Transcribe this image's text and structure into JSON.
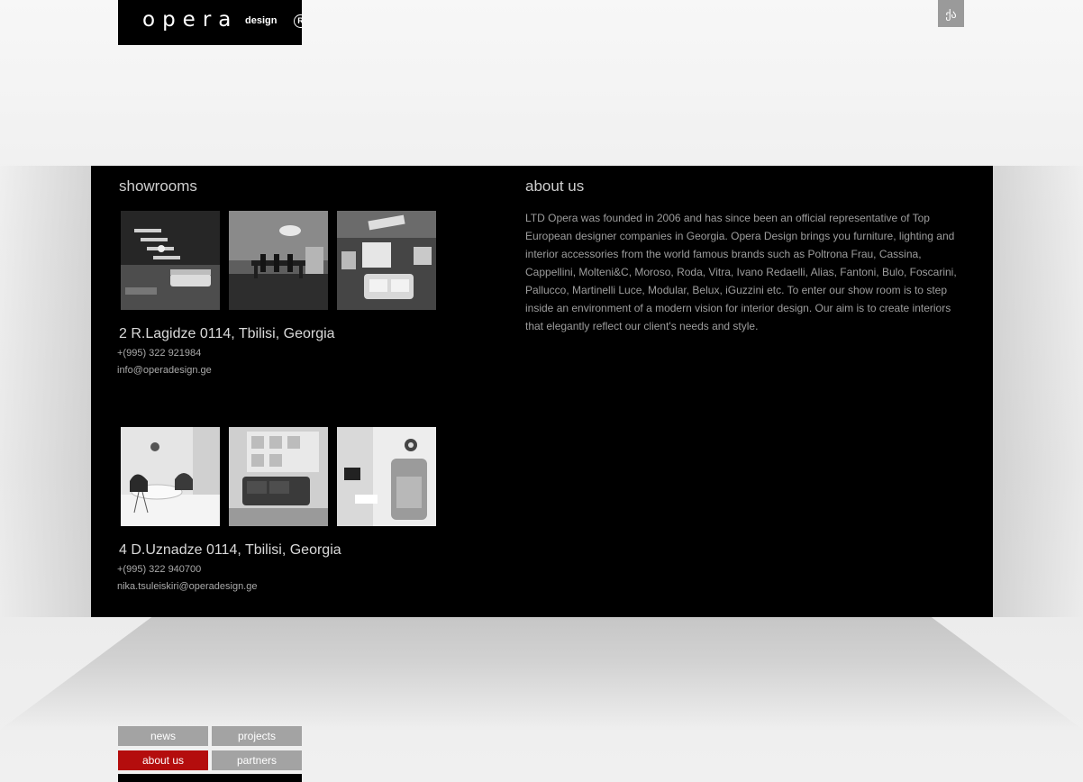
{
  "logo": {
    "word": "opera",
    "subword": "design",
    "mark": "R"
  },
  "language_switch": {
    "label": "ქა"
  },
  "showrooms": {
    "title": "showrooms",
    "locations": [
      {
        "address": "2 R.Lagidze 0114, Tbilisi, Georgia",
        "phone": "+(995) 322 921984",
        "email": "info@operadesign.ge",
        "photos": [
          "interior-photo-staircase",
          "interior-photo-dining",
          "interior-photo-sofa-top"
        ]
      },
      {
        "address": "4 D.Uznadze 0114, Tbilisi, Georgia",
        "phone": "+(995) 322 940700",
        "email": "nika.tsuleiskiri@operadesign.ge",
        "photos": [
          "interior-photo-chairs",
          "interior-photo-lounge",
          "interior-photo-booth"
        ]
      }
    ]
  },
  "about": {
    "title": "about us",
    "text": "LTD Opera was founded in 2006 and has since been an official representative of Top European designer companies in Georgia. Opera Design brings you furniture, lighting and interior accessories from the world famous brands such as Poltrona Frau, Cassina, Cappellini, Molteni&C, Moroso, Roda, Vitra, Ivano Redaelli, Alias, Fantoni, Bulo, Foscarini, Pallucco, Martinelli Luce, Modular, Belux, iGuzzini etc. To enter our show room is to step inside an environment of a modern vision for interior design. Our aim is to create interiors that elegantly reflect our client's needs and style."
  },
  "nav": {
    "news": "news",
    "projects": "projects",
    "about": "about us",
    "partners": "partners",
    "active": "about us"
  },
  "colors": {
    "panel": "#000000",
    "nav_button": "#a3a3a3",
    "nav_active": "#b40d0d"
  }
}
